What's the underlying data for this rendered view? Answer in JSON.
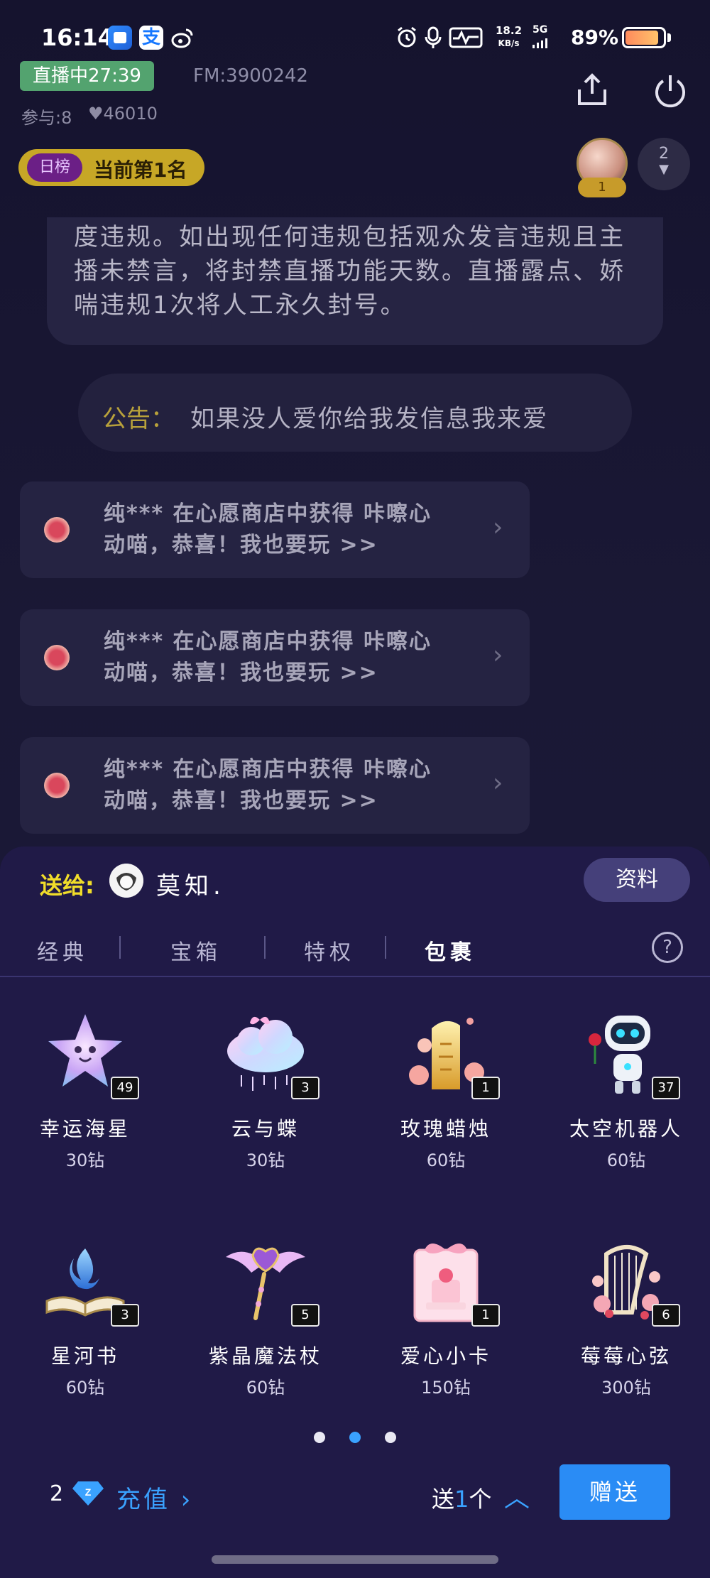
{
  "status_bar": {
    "time": "16:14",
    "net_speed_value": "18.2",
    "net_speed_unit": "KB/s",
    "signal_label": "5G",
    "battery_percent": "89%",
    "battery_level": 0.89,
    "icons": [
      "app-blue-icon",
      "alipay-icon",
      "weibo-icon",
      "alarm-icon",
      "mic-icon",
      "pulse-icon"
    ]
  },
  "live": {
    "badge": "直播中27:39",
    "fm_id": "FM:3900242",
    "participants": "参与:8",
    "likes": "46010",
    "rank_tag": "日榜",
    "rank_text": "当前第1名",
    "top_user_rank": "1",
    "online_count": "2"
  },
  "chat": {
    "rules_text": "度违规。如出现任何违规包括观众发言违规且主播未禁言，将封禁直播功能天数。直播露点、娇喘违规1次将人工永久封号。",
    "notice_label": "公告：",
    "notice_text": "如果没人爱你给我发信息我来爱",
    "system_messages": [
      {
        "line1": "纯*** 在心愿商店中获得 咔嚓心",
        "line2": "动喵，恭喜！我也要玩 >>"
      },
      {
        "line1": "纯*** 在心愿商店中获得 咔嚓心",
        "line2": "动喵，恭喜！我也要玩 >>"
      },
      {
        "line1": "纯*** 在心愿商店中获得 咔嚓心",
        "line2": "动喵，恭喜！我也要玩 >>"
      }
    ]
  },
  "gift_panel": {
    "send_to_label": "送给:",
    "recipient_name": "莫知.",
    "profile_button": "资料",
    "tabs": [
      "经典",
      "宝箱",
      "特权",
      "包裹"
    ],
    "active_tab": "包裹",
    "help": "?",
    "gifts": [
      {
        "name": "幸运海星",
        "price": "30钻",
        "count": "49",
        "icon": "starfish-icon"
      },
      {
        "name": "云与蝶",
        "price": "30钻",
        "count": "3",
        "icon": "cloud-butterfly-icon"
      },
      {
        "name": "玫瑰蜡烛",
        "price": "60钻",
        "count": "1",
        "icon": "rose-candle-icon"
      },
      {
        "name": "太空机器人",
        "price": "60钻",
        "count": "37",
        "icon": "space-robot-icon"
      },
      {
        "name": "星河书",
        "price": "60钻",
        "count": "3",
        "icon": "galaxy-book-icon"
      },
      {
        "name": "紫晶魔法杖",
        "price": "60钻",
        "count": "5",
        "icon": "magic-wand-icon"
      },
      {
        "name": "爱心小卡",
        "price": "150钻",
        "count": "1",
        "icon": "love-card-icon"
      },
      {
        "name": "莓莓心弦",
        "price": "300钻",
        "count": "6",
        "icon": "berry-harp-icon"
      }
    ],
    "page_dots": 3,
    "active_page": 2,
    "balance": "2",
    "recharge_label": "充值",
    "send_prefix": "送",
    "send_qty": "1",
    "send_unit": "个",
    "give_button": "赠送"
  },
  "colors": {
    "accent_blue": "#2a8cf5",
    "live_green": "#53a36f",
    "rank_gold": "#c7a726",
    "send_to_yellow": "#f1dd2a",
    "panel_bg": "#201a47"
  }
}
